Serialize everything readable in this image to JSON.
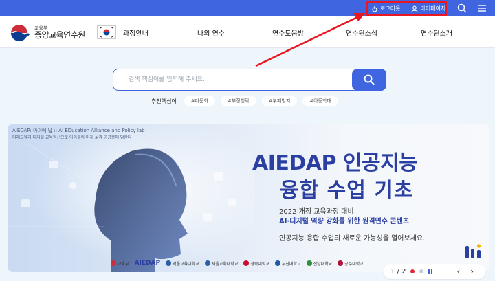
{
  "colors": {
    "brand_blue": "#3f66e0",
    "highlight_red": "#ea1720",
    "banner_title": "#2b3fa3"
  },
  "utility": {
    "logout_label": "로그아웃",
    "mypage_label": "마이페이지"
  },
  "logo": {
    "ministry": "교육부",
    "name": "중앙교육연수원"
  },
  "nav": [
    {
      "label": "과정안내"
    },
    {
      "label": "나의 연수"
    },
    {
      "label": "연수도움방"
    },
    {
      "label": "연수원소식"
    },
    {
      "label": "연수원소개"
    }
  ],
  "search": {
    "placeholder": "검색 핵심어를 입력해 주세요."
  },
  "recommended": {
    "label": "추천핵심어",
    "tags": [
      "#다문화",
      "#부정청탁",
      "#부패방지",
      "#아동학대"
    ]
  },
  "banner": {
    "caption1": "AIEDAP: 아이에 답 :: AI EDucation Alliance and Policy lab",
    "caption2": "미래교육과 디지털 교육혁신으로 아이들의 미래 삶과 공공종에 답한다",
    "title_line1": "AIEDAP 인공지능",
    "title_line2": "융합 수업 기초",
    "subtitle1": "2022 개정 교육과정 대비",
    "subtitle2": "AI·디지털 역량 강화를 위한 원격연수 콘텐츠",
    "description": "인공지능 융합 수업의 새로운 가능성을 열어보세요.",
    "partners": [
      "교육부",
      "AIEDAP",
      "서울교육대학교",
      "서울교육대학교",
      "경북대학교",
      "부산대학교",
      "전남대학교",
      "공주대학교"
    ]
  },
  "pager": {
    "count": "1 / 2"
  }
}
